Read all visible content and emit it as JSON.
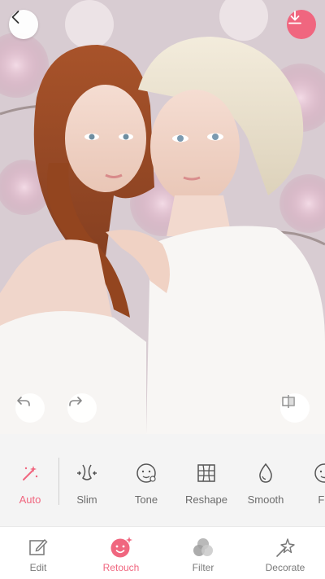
{
  "colors": {
    "accent": "#f0667f",
    "toolbar_bg": "#f4f4f4",
    "label_gray": "#6c6c6c"
  },
  "photo": {
    "description_icon": "portrait-photo"
  },
  "top_bar": {
    "back_icon": "chevron-left-icon",
    "download_icon": "download-icon"
  },
  "photo_controls": {
    "undo_icon": "undo-icon",
    "redo_icon": "redo-icon",
    "compare_icon": "compare-icon"
  },
  "tools": [
    {
      "label": "Auto",
      "icon": "magic-wand-icon",
      "active": true
    },
    {
      "label": "Slim",
      "icon": "slim-body-icon",
      "active": false
    },
    {
      "label": "Tone",
      "icon": "face-tone-icon",
      "active": false
    },
    {
      "label": "Reshape",
      "icon": "reshape-grid-icon",
      "active": false
    },
    {
      "label": "Smooth",
      "icon": "smooth-drop-icon",
      "active": false
    },
    {
      "label": "Fir",
      "icon": "face-icon",
      "active": false
    }
  ],
  "bottom_nav": [
    {
      "label": "Edit",
      "icon": "pencil-edit-icon",
      "active": false
    },
    {
      "label": "Retouch",
      "icon": "retouch-face-icon",
      "active": true
    },
    {
      "label": "Filter",
      "icon": "filter-circles-icon",
      "active": false
    },
    {
      "label": "Decorate",
      "icon": "sparkle-wand-icon",
      "active": false
    }
  ]
}
